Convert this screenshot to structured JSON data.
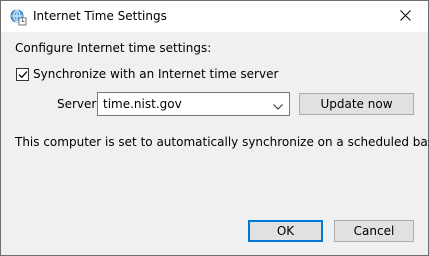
{
  "window": {
    "title": "Internet Time Settings",
    "title_icon": "internet-time-icon",
    "close_icon": "close-icon"
  },
  "content": {
    "heading": "Configure Internet time settings:",
    "sync": {
      "label": "Synchronize with an Internet time server",
      "checked": true
    },
    "server": {
      "label": "Server:",
      "value": "time.nist.gov"
    },
    "update_button": "Update now",
    "status": "This computer is set to automatically synchronize on a scheduled basis."
  },
  "footer": {
    "ok_label": "OK",
    "cancel_label": "Cancel"
  },
  "colors": {
    "dialog_background": "#f0f0f0",
    "titlebar_background": "#ffffff",
    "default_button_border": "#0078d7",
    "button_background": "#e1e1e1"
  }
}
